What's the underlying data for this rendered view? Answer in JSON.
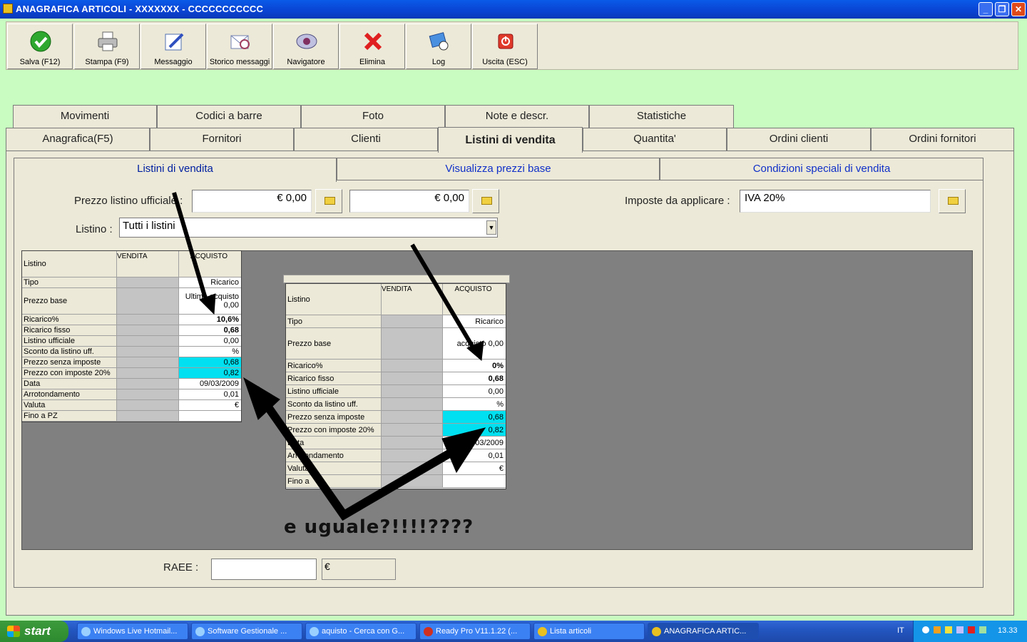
{
  "window": {
    "title": "ANAGRAFICA ARTICOLI - XXXXXXX - CCCCCCCCCCC"
  },
  "toolbar": [
    {
      "label": "Salva (F12)",
      "icon": "check-icon"
    },
    {
      "label": "Stampa (F9)",
      "icon": "printer-icon"
    },
    {
      "label": "Messaggio",
      "icon": "message-icon"
    },
    {
      "label": "Storico messaggi",
      "icon": "message-history-icon"
    },
    {
      "label": "Navigatore",
      "icon": "navigator-icon"
    },
    {
      "label": "Elimina",
      "icon": "delete-icon"
    },
    {
      "label": "Log",
      "icon": "log-icon"
    },
    {
      "label": "Uscita (ESC)",
      "icon": "exit-icon"
    }
  ],
  "tabs_row1": [
    "Movimenti",
    "Codici a barre",
    "Foto",
    "Note e descr.",
    "Statistiche"
  ],
  "tabs_row2": [
    "Anagrafica(F5)",
    "Fornitori",
    "Clienti",
    "Listini di vendita",
    "Quantita'",
    "Ordini clienti",
    "Ordini fornitori"
  ],
  "subtabs": [
    "Listini di vendita",
    "Visualizza prezzi base",
    "Condizioni speciali di vendita"
  ],
  "form": {
    "prezzo_label": "Prezzo listino ufficiale :",
    "prezzo_value1": "€ 0,00",
    "prezzo_value2": "€ 0,00",
    "imposte_label": "Imposte da applicare :",
    "imposte_value": "IVA 20%",
    "listino_label": "Listino :",
    "listino_value": "Tutti i listini",
    "raee_label": "RAEE :",
    "raee_currency": "€"
  },
  "grid1": {
    "headers": [
      "Listino",
      "VENDITA",
      "ACQUISTO"
    ],
    "rows": [
      [
        "Tipo",
        "",
        "Ricarico"
      ],
      [
        "Prezzo base",
        "",
        "Ultimo acquisto 0,00"
      ],
      [
        "Ricarico%",
        "",
        "10,6%"
      ],
      [
        "Ricarico fisso",
        "",
        "0,68"
      ],
      [
        "Listino ufficiale",
        "",
        "0,00"
      ],
      [
        "Sconto da listino uff.",
        "",
        "%"
      ],
      [
        "Prezzo senza imposte",
        "",
        "0,68"
      ],
      [
        "Prezzo con imposte 20%",
        "",
        "0,82"
      ],
      [
        "Data",
        "",
        "09/03/2009"
      ],
      [
        "Arrotondamento",
        "",
        "0,01"
      ],
      [
        "Valuta",
        "",
        "€"
      ],
      [
        "Fino a PZ",
        "",
        ""
      ]
    ]
  },
  "grid2": {
    "headers": [
      "Listino",
      "VENDITA",
      "ACQUISTO"
    ],
    "rows": [
      [
        "Tipo",
        "",
        "Ricarico"
      ],
      [
        "Prezzo base",
        "",
        "acquisto 0,00"
      ],
      [
        "Ricarico%",
        "",
        "0%"
      ],
      [
        "Ricarico fisso",
        "",
        "0,68"
      ],
      [
        "Listino ufficiale",
        "",
        "0,00"
      ],
      [
        "Sconto da listino uff.",
        "",
        "%"
      ],
      [
        "Prezzo senza imposte",
        "",
        "0,68"
      ],
      [
        "Prezzo con imposte 20%",
        "",
        "0,82"
      ],
      [
        "Data",
        "",
        "09/03/2009"
      ],
      [
        "Arrotondamento",
        "",
        "0,01"
      ],
      [
        "Valuta",
        "",
        "€"
      ],
      [
        "Fino a",
        "",
        ""
      ]
    ]
  },
  "annotation": "e uguale?!!!!????",
  "taskbar": {
    "start": "start",
    "tasks": [
      "Windows Live Hotmail...",
      "Software Gestionale ...",
      "aquisto - Cerca con G...",
      "Ready Pro V11.1.22 (...",
      "Lista articoli",
      "ANAGRAFICA ARTIC..."
    ],
    "lang": "IT",
    "clock": "13.33"
  }
}
